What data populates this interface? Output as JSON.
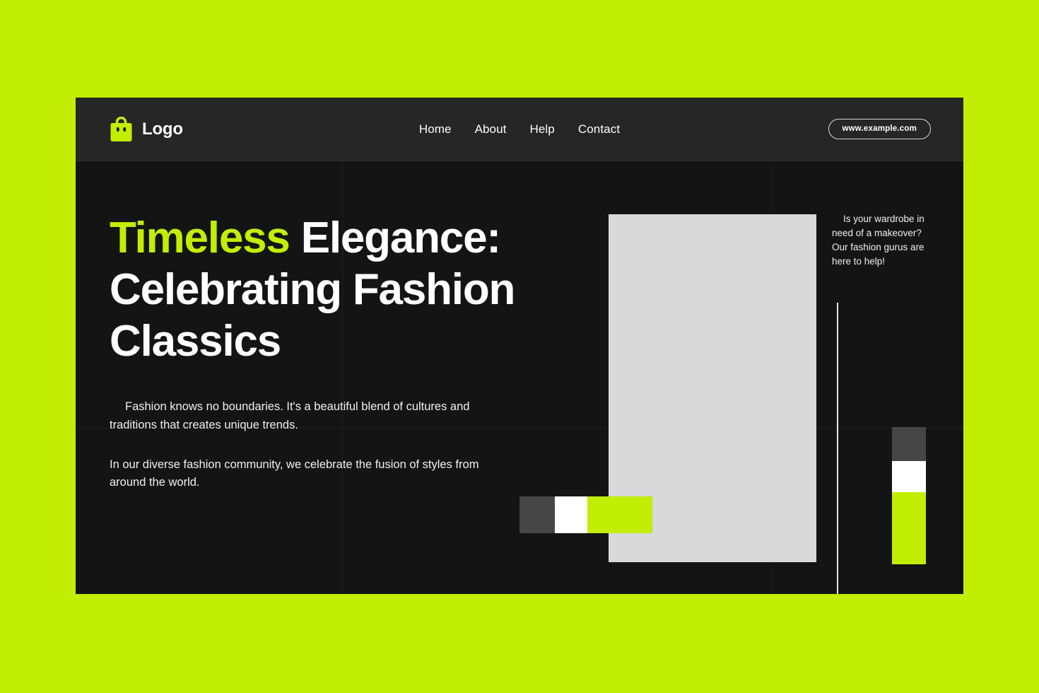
{
  "theme": {
    "page_background": "#c2ee04",
    "panel_background": "#141414",
    "header_background": "#262626",
    "accent": "#c2ee04",
    "text_primary": "#ffffff",
    "image_placeholder": "#d9d9d9",
    "swatch_dark": "#464646",
    "swatch_white": "#ffffff"
  },
  "header": {
    "logo_icon": "shopping-bag-icon",
    "brand_name": "Logo",
    "nav": [
      {
        "label": "Home"
      },
      {
        "label": "About"
      },
      {
        "label": "Help"
      },
      {
        "label": "Contact"
      }
    ],
    "url_button": "www.example.com"
  },
  "hero": {
    "headline_accent": "Timeless",
    "headline_rest": " Elegance: Celebrating Fashion Classics",
    "paragraph_1": "Fashion knows no boundaries. It's a beautiful blend of cultures and traditions that creates unique trends.",
    "paragraph_2": "In our diverse fashion community, we celebrate the fusion of styles from around the world."
  },
  "sidebar": {
    "note": "Is your wardrobe in need of a makeover? Our fashion gurus are here to help!"
  },
  "swatches": {
    "horizontal": [
      {
        "name": "swatch-dark",
        "color": "#464646"
      },
      {
        "name": "swatch-white",
        "color": "#ffffff"
      },
      {
        "name": "swatch-green",
        "color": "#c2ee04"
      }
    ],
    "vertical": [
      {
        "name": "swatch-dark",
        "color": "#464646"
      },
      {
        "name": "swatch-white",
        "color": "#ffffff"
      },
      {
        "name": "swatch-green",
        "color": "#c2ee04"
      }
    ]
  }
}
